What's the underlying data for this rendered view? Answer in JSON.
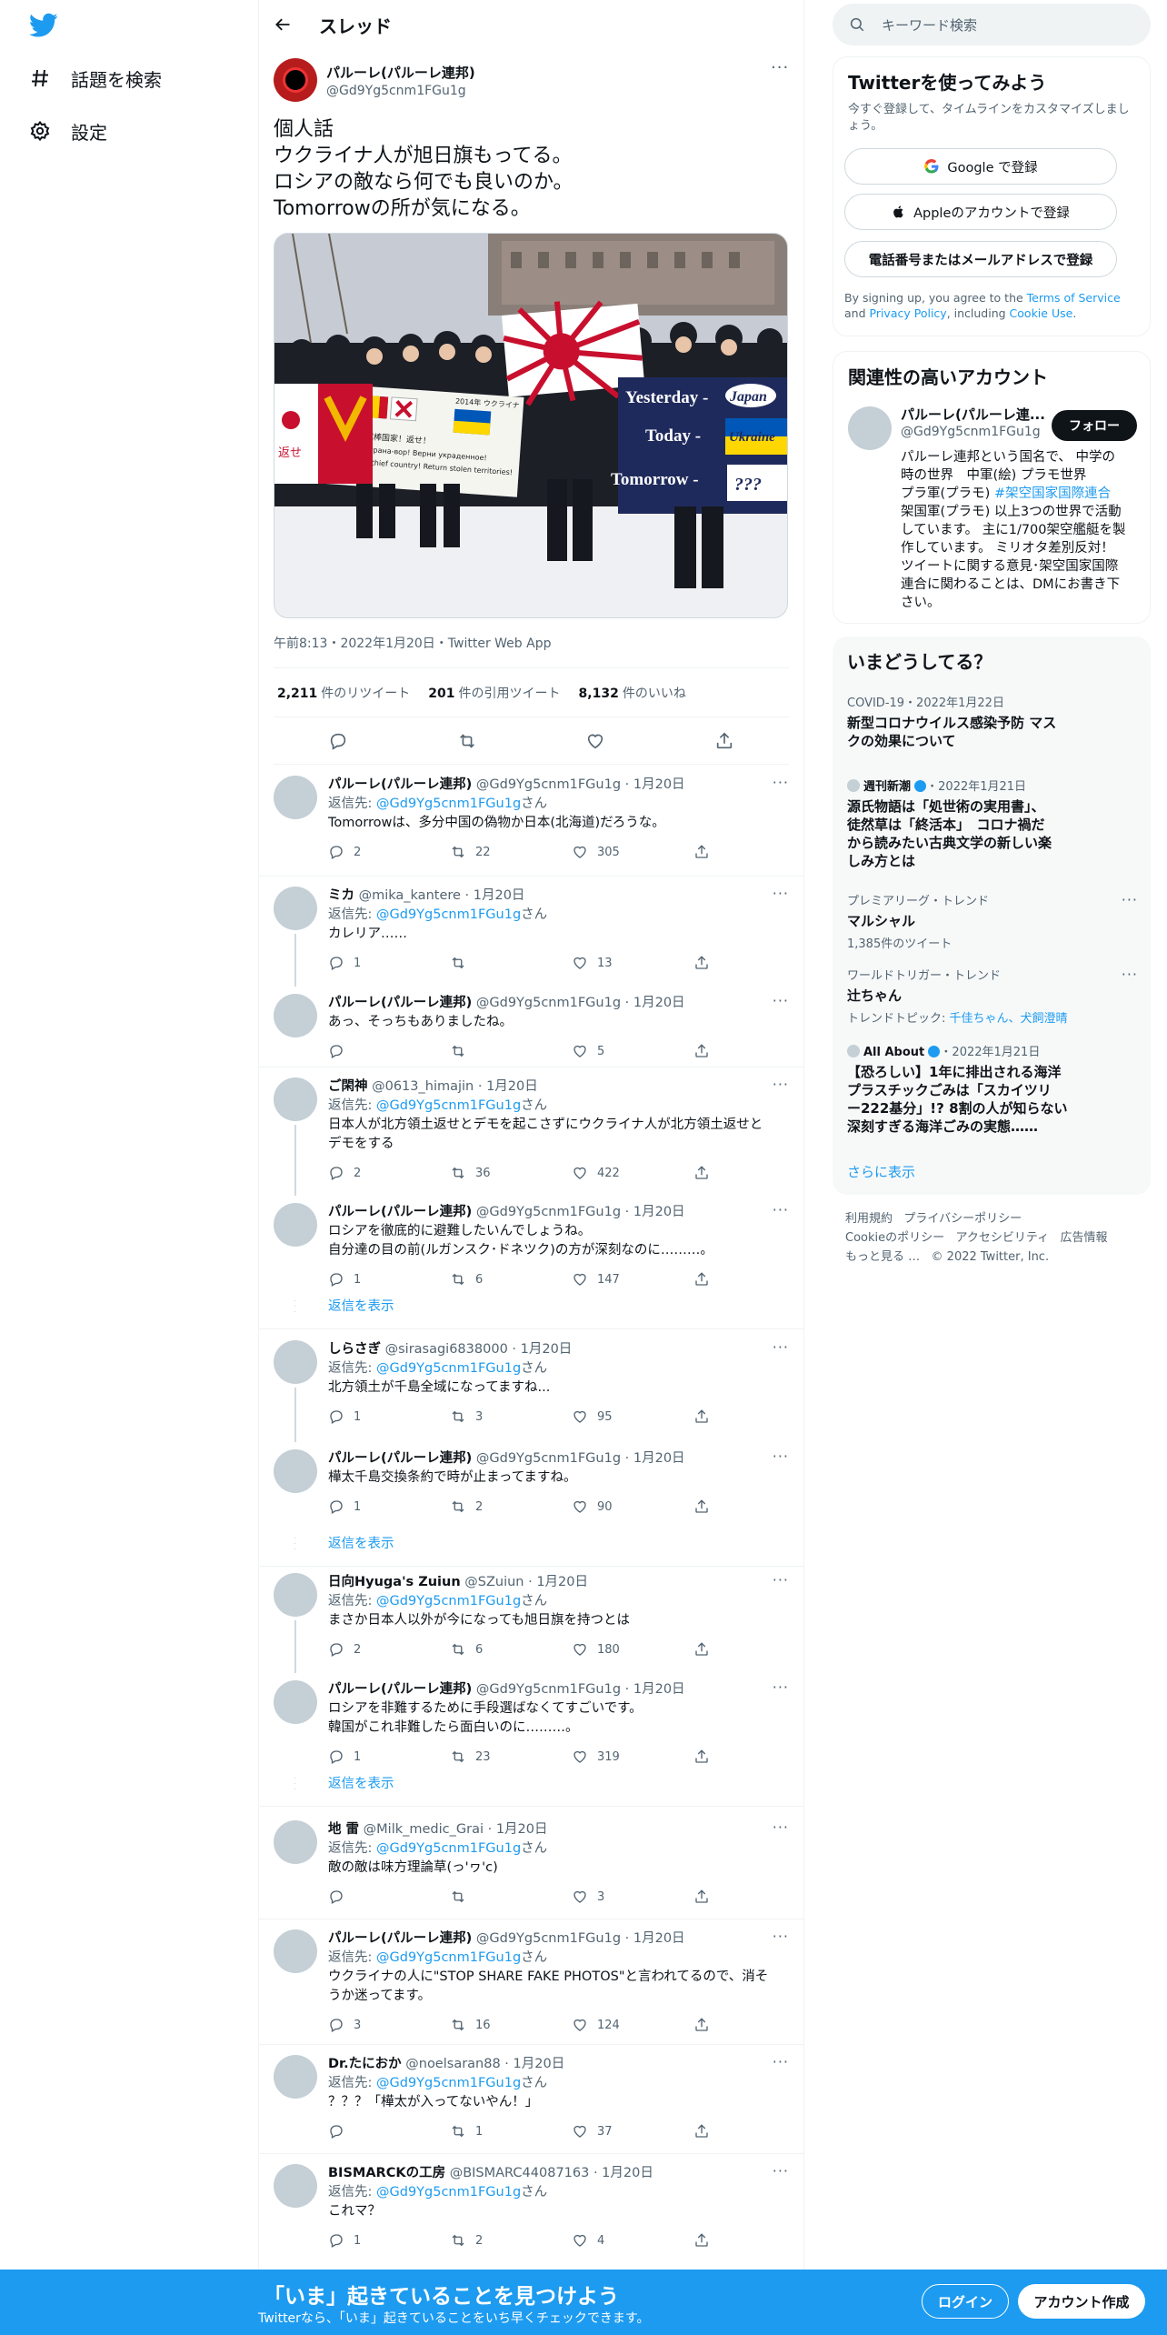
{
  "nav": {
    "explore_label": "話題を検索",
    "settings_label": "設定"
  },
  "header": {
    "title": "スレッド"
  },
  "main_tweet": {
    "name": "パルーレ(パルーレ連邦)",
    "handle": "@Gd9Yg5cnm1FGu1g",
    "lines": [
      "個人話",
      "ウクライナ人が旭日旗もってる。",
      "ロシアの敵なら何でも良いのか。",
      "Tomorrowの所が気になる。"
    ],
    "photo_signs": {
      "yesterday": "Yesterday -",
      "japan": "Japan",
      "today": "Today -",
      "ukraine": "Ukraine",
      "tomorrow": "Tomorrow -",
      "qmarks": "???",
      "white_sign_1": "ロシアは泥棒国家！返せ！",
      "white_sign_2": "Россия - страна-вор! Верни украденное!",
      "white_sign_3": "Russia is a thief country! Return stolen territories!",
      "year_label": "2014年 ウクライナ",
      "left_sign": "返せ"
    },
    "meta": "午前8:13・2022年1月20日・Twitter Web App",
    "retweets_num": "2,211",
    "retweets_label": "件のリツイート",
    "quotes_num": "201",
    "quotes_label": "件の引用ツイート",
    "likes_num": "8,132",
    "likes_label": "件のいいね"
  },
  "replying_to_prefix": "返信先: ",
  "replying_to_handle": "@Gd9Yg5cnm1FGu1g",
  "replying_to_suffix": "さん",
  "show_replies_label": "返信を表示",
  "replies": [
    {
      "name": "パルーレ(パルーレ連邦)",
      "meta": "@Gd9Yg5cnm1FGu1g · 1月20日",
      "reply_to": true,
      "lines": [
        "Tomorrowは、多分中国の偽物か日本(北海道)だろうな。"
      ],
      "replies": "2",
      "retweets": "22",
      "likes": "305"
    },
    {
      "name": "ミカ",
      "meta": "@mika_kantere · 1月20日",
      "reply_to": true,
      "lines": [
        "カレリア……"
      ],
      "replies": "1",
      "retweets": "",
      "likes": "13"
    },
    {
      "name": "パルーレ(パルーレ連邦)",
      "meta": "@Gd9Yg5cnm1FGu1g · 1月20日",
      "reply_to": false,
      "lines": [
        "あっ、そっちもありましたね。"
      ],
      "replies": "",
      "retweets": "",
      "likes": "5"
    },
    {
      "name": "ご閑神",
      "meta": "@0613_himajin · 1月20日",
      "reply_to": true,
      "lines": [
        "日本人が北方領土返せとデモを起こさずにウクライナ人が北方領土返せと",
        "デモをする"
      ],
      "replies": "2",
      "retweets": "36",
      "likes": "422"
    },
    {
      "name": "パルーレ(パルーレ連邦)",
      "meta": "@Gd9Yg5cnm1FGu1g · 1月20日",
      "reply_to": false,
      "lines": [
        "ロシアを徹底的に避難したいんでしょうね。",
        "自分達の目の前(ルガンスク･ドネツク)の方が深刻なのに………。"
      ],
      "replies": "1",
      "retweets": "6",
      "likes": "147"
    },
    {
      "name": "しらさぎ",
      "meta": "@sirasagi6838000 · 1月20日",
      "reply_to": true,
      "lines": [
        "北方領土が千島全域になってますね..."
      ],
      "replies": "1",
      "retweets": "3",
      "likes": "95"
    },
    {
      "name": "パルーレ(パルーレ連邦)",
      "meta": "@Gd9Yg5cnm1FGu1g · 1月20日",
      "reply_to": false,
      "lines": [
        "樺太千島交換条約で時が止まってますね。"
      ],
      "replies": "1",
      "retweets": "2",
      "likes": "90"
    },
    {
      "name": "日向Hyuga's Zuiun",
      "meta": "@SZuiun · 1月20日",
      "reply_to": true,
      "lines": [
        "まさか日本人以外が今になっても旭日旗を持つとは"
      ],
      "replies": "2",
      "retweets": "6",
      "likes": "180"
    },
    {
      "name": "パルーレ(パルーレ連邦)",
      "meta": "@Gd9Yg5cnm1FGu1g · 1月20日",
      "reply_to": false,
      "lines": [
        "ロシアを非難するために手段選ばなくてすごいです。",
        "韓国がこれ非難したら面白いのに………。"
      ],
      "replies": "1",
      "retweets": "23",
      "likes": "319"
    },
    {
      "name": "地 雷",
      "meta": "@Milk_medic_Grai · 1月20日",
      "reply_to": true,
      "lines": [
        "敵の敵は味方理論草(っ'ヮ'c)"
      ],
      "replies": "",
      "retweets": "",
      "likes": "3"
    },
    {
      "name": "パルーレ(パルーレ連邦)",
      "meta": "@Gd9Yg5cnm1FGu1g · 1月20日",
      "reply_to": true,
      "lines": [
        "ウクライナの人に\"STOP SHARE FAKE PHOTOS\"と言われてるので、消そ",
        "うか迷ってます。"
      ],
      "replies": "3",
      "retweets": "16",
      "likes": "124"
    },
    {
      "name": "Dr.たにおか",
      "meta": "@noelsaran88 · 1月20日",
      "reply_to": true,
      "lines": [
        "？？？「樺太が入ってないやん！」"
      ],
      "replies": "",
      "retweets": "1",
      "likes": "37"
    },
    {
      "name": "BISMARCKの工房",
      "meta": "@BISMARC44087163 · 1月20日",
      "reply_to": true,
      "lines": [
        "これマ？"
      ],
      "replies": "1",
      "retweets": "2",
      "likes": "4"
    }
  ],
  "search": {
    "placeholder": "キーワード検索"
  },
  "signup_card": {
    "title": "Twitterを使ってみよう",
    "subtitle": "今すぐ登録して、タイムラインをカスタマイズしましょう。",
    "google_label": "Google で登録",
    "apple_label": "Appleのアカウントで登録",
    "phone_label": "電話番号またはメールアドレスで登録",
    "terms_pre": "By signing up, you agree to the ",
    "terms_tos": "Terms of Service",
    "terms_and": " and ",
    "terms_privacy": "Privacy Policy",
    "terms_including": ", including ",
    "terms_cookie": "Cookie Use",
    "terms_end": "."
  },
  "relevant_card": {
    "title": "関連性の高いアカウント",
    "name": "パルーレ(パルーレ連...",
    "handle": "@Gd9Yg5cnm1FGu1g",
    "follow_label": "フォロー",
    "bio_1": "パルーレ連邦という国名で、 中学の",
    "bio_2": "時の世界　中軍(絵) プラモ世界",
    "bio_3a": "プラ軍(プラモ) ",
    "bio_3b": "#架空国家国際連合",
    "bio_4": "架国軍(プラモ) 以上3つの世界で活動",
    "bio_5": "しています。 主に1/700架空艦艇を製",
    "bio_6": "作しています。 ミリオタ差別反対！",
    "bio_7": "ツイートに関する意見･架空国家国際",
    "bio_8": "連合に関わることは、DMにお書き下",
    "bio_9": "さい。"
  },
  "trends_card": {
    "title": "いまどうしてる？",
    "t1_ctx": "COVID-19・2022年1月22日",
    "t1_title_1": "新型コロナウイルス感染予防 マス",
    "t1_title_2": "クの効果について",
    "t2_src": "週刊新潮",
    "t2_date": "・2022年1月21日",
    "t2_title_1": "源氏物語は「処世術の実用書」、",
    "t2_title_2": "徒然草は「終活本」　コロナ禍だ",
    "t2_title_3": "から読みたい古典文学の新しい楽",
    "t2_title_4": "しみ方とは",
    "t3_ctx": "プレミアリーグ・トレンド",
    "t3_title": "マルシャル",
    "t3_sub": "1,385件のツイート",
    "t4_ctx": "ワールドトリガー・トレンド",
    "t4_title": "辻ちゃん",
    "t4_sub_pre": "トレンドトピック: ",
    "t4_sub_links": "千佳ちゃん、犬飼澄晴",
    "t5_src": "All About",
    "t5_date": "・2022年1月21日",
    "t5_title_1": "【恐ろしい】1年に排出される海洋",
    "t5_title_2": "プラスチックごみは「スカイツリ",
    "t5_title_3": "ー222基分」!? 8割の人が知らない",
    "t5_title_4": "深刻すぎる海洋ごみの実態……",
    "more_label": "さらに表示"
  },
  "footer": {
    "terms": "利用規約",
    "privacy": "プライバシーポリシー",
    "cookie": "Cookieのポリシー",
    "accessibility": "アクセシビリティ",
    "ads": "広告情報",
    "more": "もっと見る …",
    "copyright": "© 2022 Twitter, Inc."
  },
  "banner": {
    "headline": "「いま」起きていることを見つけよう",
    "sub": "Twitterなら、「いま」起きていることをいち早くチェックできます。",
    "login_label": "ログイン",
    "signup_label": "アカウント作成"
  },
  "colors": {
    "accent": "#1d9bf0",
    "text": "#0f1419",
    "muted": "#536471"
  }
}
